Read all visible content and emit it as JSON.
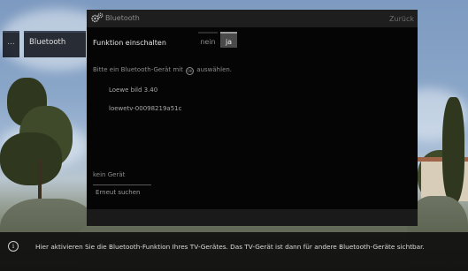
{
  "breadcrumb": {
    "more_label": "...",
    "current_label": "Bluetooth"
  },
  "dialog": {
    "title": "Bluetooth",
    "back_label": "Zurück",
    "function_label": "Funktion einschalten",
    "options": [
      "nein",
      "ja"
    ],
    "selected_option": "ja",
    "instruction_prefix": "Bitte ein Bluetooth-Gerät mit",
    "instruction_icon_text": "OK",
    "instruction_suffix": "auswählen.",
    "devices": [
      "Loewe bild 3.40",
      "loewetv-00098219a51c"
    ],
    "status_text": "kein Gerät",
    "rescan_label": "Erneut suchen"
  },
  "info": {
    "icon_glyph": "i",
    "text": "Hier aktivieren Sie die Bluetooth-Funktion Ihres TV-Gerätes. Das TV-Gerät ist dann für andere Bluetooth-Geräte sichtbar."
  },
  "icons": {
    "settings": "gear-icon",
    "info": "info-icon",
    "ok_button": "ok-icon"
  },
  "colors": {
    "dialog_background": "#050505",
    "header_background": "#1e1e1e",
    "selected_option_background": "#4a4a4a",
    "info_bar_background": "#0c0c0c"
  }
}
